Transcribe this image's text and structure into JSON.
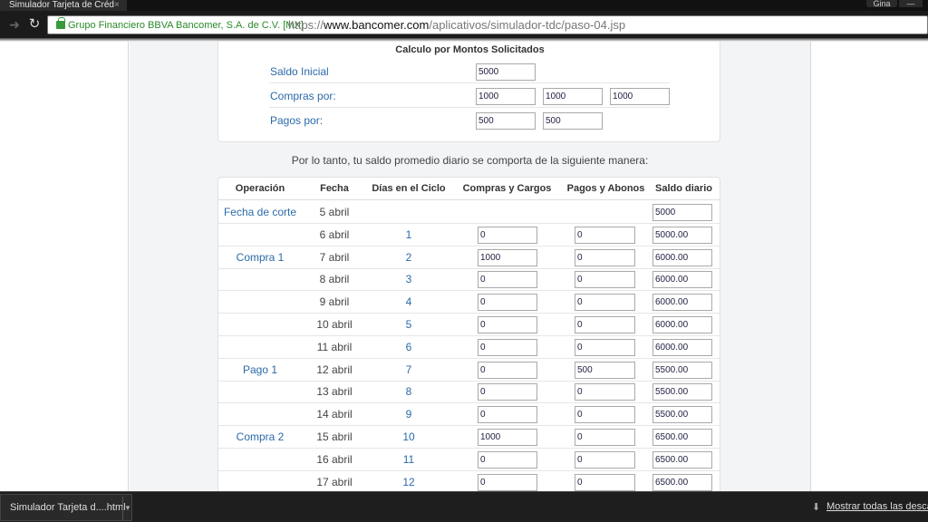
{
  "browser": {
    "tab_title": "Simulador Tarjeta de Créd",
    "tab_close": "×",
    "user_name": "Gina",
    "window_btn": "—",
    "ev_label": "Grupo Financiero BBVA Bancomer, S.A. de C.V. [MX]",
    "url_scheme": "https://",
    "url_host": "www.bancomer.com",
    "url_path": "/aplicativos/simulador-tdc/paso-04.jsp"
  },
  "panel": {
    "title": "Calculo por Montos Solicitados",
    "rows": [
      {
        "label": "Saldo Inicial",
        "values": [
          "5000"
        ]
      },
      {
        "label": "Compras por:",
        "values": [
          "1000",
          "1000",
          "1000"
        ]
      },
      {
        "label": "Pagos por:",
        "values": [
          "500",
          "500"
        ]
      }
    ]
  },
  "summary": "Por lo tanto, tu saldo promedio diario se comporta de la siguiente manera:",
  "table": {
    "headers": [
      "Operación",
      "Fecha",
      "Días en el Ciclo",
      "Compras y Cargos",
      "Pagos y Abonos",
      "Saldo diario"
    ],
    "rows": [
      {
        "op": "Fecha de corte",
        "fecha": "5 abril",
        "dias": "",
        "compras": "",
        "pagos": "",
        "saldo": "5000"
      },
      {
        "op": "",
        "fecha": "6 abril",
        "dias": "1",
        "compras": "0",
        "pagos": "0",
        "saldo": "5000.00"
      },
      {
        "op": "Compra 1",
        "fecha": "7 abril",
        "dias": "2",
        "compras": "1000",
        "pagos": "0",
        "saldo": "6000.00"
      },
      {
        "op": "",
        "fecha": "8 abril",
        "dias": "3",
        "compras": "0",
        "pagos": "0",
        "saldo": "6000.00"
      },
      {
        "op": "",
        "fecha": "9 abril",
        "dias": "4",
        "compras": "0",
        "pagos": "0",
        "saldo": "6000.00"
      },
      {
        "op": "",
        "fecha": "10 abril",
        "dias": "5",
        "compras": "0",
        "pagos": "0",
        "saldo": "6000.00"
      },
      {
        "op": "",
        "fecha": "11 abril",
        "dias": "6",
        "compras": "0",
        "pagos": "0",
        "saldo": "6000.00"
      },
      {
        "op": "Pago 1",
        "fecha": "12 abril",
        "dias": "7",
        "compras": "0",
        "pagos": "500",
        "saldo": "5500.00"
      },
      {
        "op": "",
        "fecha": "13 abril",
        "dias": "8",
        "compras": "0",
        "pagos": "0",
        "saldo": "5500.00"
      },
      {
        "op": "",
        "fecha": "14 abril",
        "dias": "9",
        "compras": "0",
        "pagos": "0",
        "saldo": "5500.00"
      },
      {
        "op": "Compra 2",
        "fecha": "15 abril",
        "dias": "10",
        "compras": "1000",
        "pagos": "0",
        "saldo": "6500.00"
      },
      {
        "op": "",
        "fecha": "16 abril",
        "dias": "11",
        "compras": "0",
        "pagos": "0",
        "saldo": "6500.00"
      },
      {
        "op": "",
        "fecha": "17 abril",
        "dias": "12",
        "compras": "0",
        "pagos": "0",
        "saldo": "6500.00"
      }
    ]
  },
  "downloads": {
    "item": "Simulador Tarjeta d....html",
    "show_all": "Mostrar todas las descargas"
  }
}
